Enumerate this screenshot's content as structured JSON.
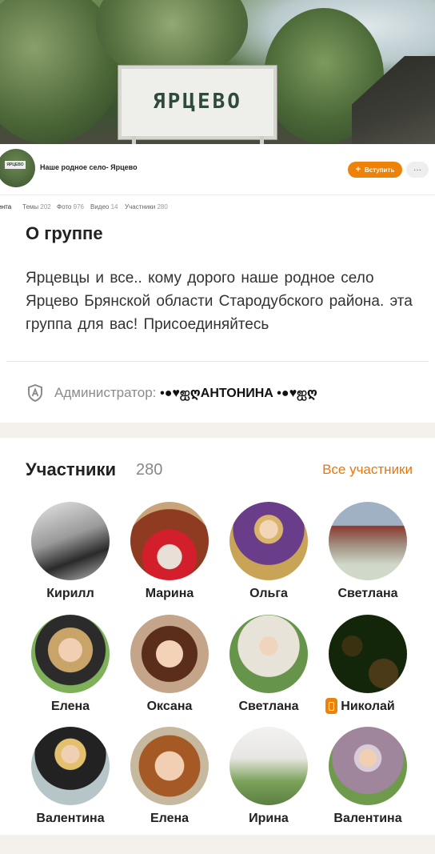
{
  "cover": {
    "sign_text": "ЯРЦЕВО"
  },
  "group": {
    "title": "Наше родное село- Ярцево",
    "join_label": "Вступить",
    "more_label": "···",
    "avatar_sign": "ЯРЦЕВО"
  },
  "tabs": [
    {
      "label": "Лента",
      "count": ""
    },
    {
      "label": "Темы",
      "count": "202"
    },
    {
      "label": "Фото",
      "count": "976"
    },
    {
      "label": "Видео",
      "count": "14"
    },
    {
      "label": "Участники",
      "count": "280"
    }
  ],
  "about": {
    "heading": "О группе",
    "description": "Ярцевцы и все.. кому дорого наше родное село Ярцево Брянской области Стародубского района. эта группа для вас! Присоединяйтесь",
    "admin_label": "Администратор:",
    "admin_name": "•●♥ஐღАНТОНИНА •●♥ஐღ"
  },
  "members": {
    "heading": "Участники",
    "count": "280",
    "all_label": "Все участники",
    "list": [
      {
        "name": "Кирилл"
      },
      {
        "name": "Марина"
      },
      {
        "name": "Ольга"
      },
      {
        "name": "Светлана"
      },
      {
        "name": "Елена"
      },
      {
        "name": "Оксана"
      },
      {
        "name": "Светлана"
      },
      {
        "name": "Николай",
        "badge": true
      },
      {
        "name": "Валентина"
      },
      {
        "name": "Елена"
      },
      {
        "name": "Ирина"
      },
      {
        "name": "Валентина"
      }
    ]
  },
  "colors": {
    "accent": "#ee8208",
    "link": "#e8760a",
    "page_bg": "#f4f0ec"
  }
}
